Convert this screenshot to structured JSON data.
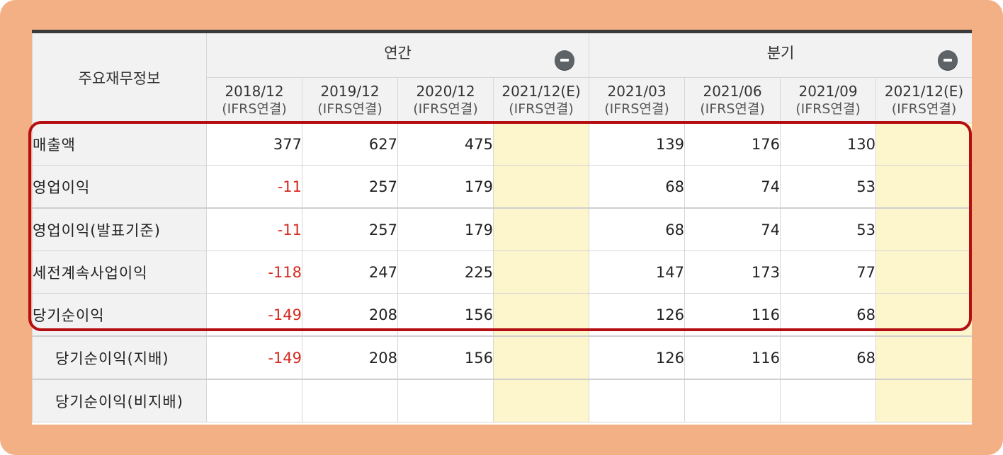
{
  "table": {
    "corner_label": "주요재무정보",
    "groups": [
      {
        "label": "연간"
      },
      {
        "label": "분기"
      }
    ],
    "columns": [
      {
        "period": "2018/12",
        "basis": "(IFRS연결)"
      },
      {
        "period": "2019/12",
        "basis": "(IFRS연결)"
      },
      {
        "period": "2020/12",
        "basis": "(IFRS연결)"
      },
      {
        "period": "2021/12(E)",
        "basis": "(IFRS연결)"
      },
      {
        "period": "2021/03",
        "basis": "(IFRS연결)"
      },
      {
        "period": "2021/06",
        "basis": "(IFRS연결)"
      },
      {
        "period": "2021/09",
        "basis": "(IFRS연결)"
      },
      {
        "period": "2021/12(E)",
        "basis": "(IFRS연결)"
      }
    ],
    "rows": [
      {
        "label": "매출액",
        "values": [
          "377",
          "627",
          "475",
          "",
          "139",
          "176",
          "130",
          ""
        ]
      },
      {
        "label": "영업이익",
        "values": [
          "-11",
          "257",
          "179",
          "",
          "68",
          "74",
          "53",
          ""
        ]
      },
      {
        "label": "영업이익(발표기준)",
        "values": [
          "-11",
          "257",
          "179",
          "",
          "68",
          "74",
          "53",
          ""
        ]
      },
      {
        "label": "세전계속사업이익",
        "values": [
          "-118",
          "247",
          "225",
          "",
          "147",
          "173",
          "77",
          ""
        ]
      },
      {
        "label": "당기순이익",
        "values": [
          "-149",
          "208",
          "156",
          "",
          "126",
          "116",
          "68",
          ""
        ]
      },
      {
        "label": "당기순이익(지배)",
        "values": [
          "-149",
          "208",
          "156",
          "",
          "126",
          "116",
          "68",
          ""
        ]
      },
      {
        "label": "당기순이익(비지배)",
        "values": [
          "",
          "",
          "",
          "",
          "",
          "",
          "",
          ""
        ]
      }
    ]
  },
  "colors": {
    "frame_background": "#f3b085",
    "highlight_border": "#b50e12",
    "negative_value": "#d42a1f",
    "estimate_cell": "#fdf6cc",
    "header_background": "#f2f2f2"
  },
  "icons": {
    "group_toggle": "minus-circle-icon"
  }
}
